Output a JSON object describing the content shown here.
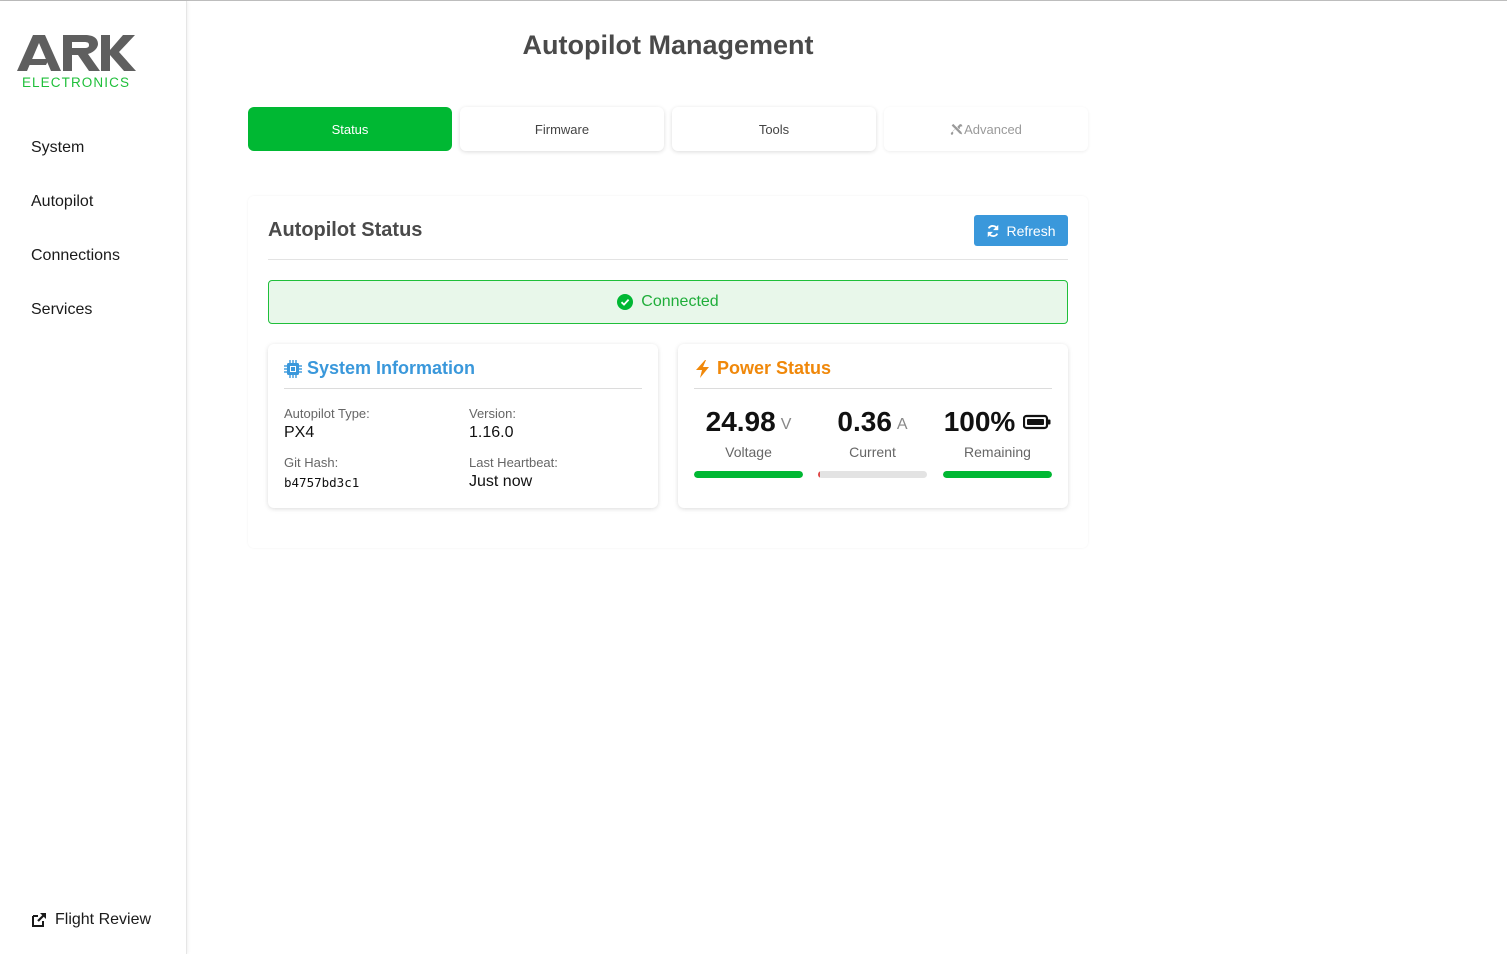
{
  "brand": {
    "logo_text": "ARK",
    "logo_subtext": "ELECTRONICS",
    "logo_color": "#5f5f5f",
    "accent_color": "#1fbf3a"
  },
  "sidebar": {
    "items": [
      {
        "label": "System"
      },
      {
        "label": "Autopilot"
      },
      {
        "label": "Connections"
      },
      {
        "label": "Services"
      }
    ],
    "footer_link": {
      "label": "Flight Review",
      "icon": "external-link-icon"
    }
  },
  "page": {
    "title": "Autopilot Management"
  },
  "tabs": [
    {
      "label": "Status",
      "state": "active"
    },
    {
      "label": "Firmware",
      "state": "normal"
    },
    {
      "label": "Tools",
      "state": "normal"
    },
    {
      "label": "Advanced",
      "state": "disabled",
      "icon": "tools-icon"
    }
  ],
  "status_panel": {
    "title": "Autopilot Status",
    "refresh_label": "Refresh",
    "connection": {
      "label": "Connected",
      "icon": "check-circle-icon",
      "color": "#1fad3a"
    }
  },
  "system_info": {
    "title": "System Information",
    "icon": "cpu-chip-icon",
    "color": "#3a98db",
    "autopilot_type_label": "Autopilot Type:",
    "autopilot_type": "PX4",
    "version_label": "Version:",
    "version": "1.16.0",
    "git_hash_label": "Git Hash:",
    "git_hash": "b4757bd3c1",
    "heartbeat_label": "Last Heartbeat:",
    "heartbeat": "Just now"
  },
  "power": {
    "title": "Power Status",
    "icon": "bolt-icon",
    "color": "#f0880a",
    "voltage": {
      "value": "24.98",
      "unit": "V",
      "label": "Voltage",
      "level": 1.0,
      "color": "#00b833"
    },
    "current": {
      "value": "0.36",
      "unit": "A",
      "label": "Current",
      "level": 0.01,
      "color": "#e04848"
    },
    "remaining": {
      "value": "100%",
      "label": "Remaining",
      "icon": "battery-full-icon",
      "level": 1.0,
      "color": "#00b833"
    }
  }
}
